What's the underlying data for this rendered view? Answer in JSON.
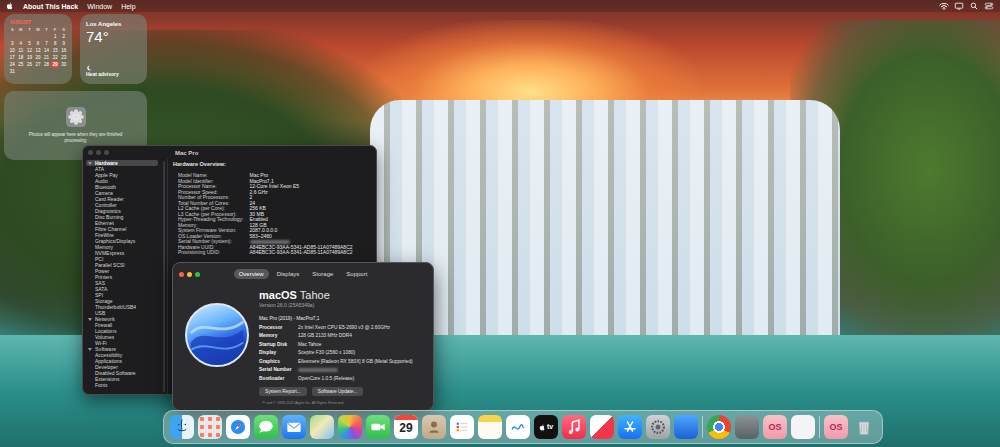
{
  "menu_bar": {
    "app_name": "About This Hack",
    "items": [
      "Window",
      "Help"
    ]
  },
  "calendar_widget": {
    "month": "AUGUST",
    "weekdays": [
      "S",
      "M",
      "T",
      "W",
      "T",
      "F",
      "S"
    ],
    "weeks": [
      [
        {
          "day": "1",
          "today": false
        },
        {
          "day": "2",
          "today": false
        }
      ],
      [
        {
          "day": "3",
          "today": false
        },
        {
          "day": "4",
          "today": false
        },
        {
          "day": "5",
          "today": false
        },
        {
          "day": "6",
          "today": false
        },
        {
          "day": "7",
          "today": false
        },
        {
          "day": "8",
          "today": false
        },
        {
          "day": "9",
          "today": false
        }
      ],
      [
        {
          "day": "10",
          "today": false
        },
        {
          "day": "11",
          "today": false
        },
        {
          "day": "12",
          "today": false
        },
        {
          "day": "13",
          "today": false
        },
        {
          "day": "14",
          "today": false
        },
        {
          "day": "15",
          "today": false
        },
        {
          "day": "16",
          "today": false
        }
      ],
      [
        {
          "day": "17",
          "today": false
        },
        {
          "day": "18",
          "today": false
        },
        {
          "day": "19",
          "today": false
        },
        {
          "day": "20",
          "today": false
        },
        {
          "day": "21",
          "today": false
        },
        {
          "day": "22",
          "today": false
        },
        {
          "day": "23",
          "today": false
        }
      ],
      [
        {
          "day": "24",
          "today": false
        },
        {
          "day": "25",
          "today": false
        },
        {
          "day": "26",
          "today": false
        },
        {
          "day": "27",
          "today": false
        },
        {
          "day": "28",
          "today": false
        },
        {
          "day": "29",
          "today": true
        },
        {
          "day": "30",
          "today": false
        }
      ],
      [
        {
          "day": "31",
          "today": false
        }
      ]
    ]
  },
  "weather_widget": {
    "city": "Los Angeles",
    "temperature": "74°",
    "condition": "Heat advisory"
  },
  "photos_widget": {
    "message": "Photos will appear here when they are finished processing"
  },
  "system_report": {
    "title": "Mac Pro",
    "sidebar": [
      {
        "label": "Hardware",
        "kind": "group",
        "expanded": true,
        "selected": true
      },
      {
        "label": "ATA",
        "kind": "item",
        "expanded": false,
        "selected": false
      },
      {
        "label": "Apple Pay",
        "kind": "item",
        "expanded": false,
        "selected": false
      },
      {
        "label": "Audio",
        "kind": "item",
        "expanded": false,
        "selected": false
      },
      {
        "label": "Bluetooth",
        "kind": "item",
        "expanded": false,
        "selected": false
      },
      {
        "label": "Camera",
        "kind": "item",
        "expanded": false,
        "selected": false
      },
      {
        "label": "Card Reader",
        "kind": "item",
        "expanded": false,
        "selected": false
      },
      {
        "label": "Controller",
        "kind": "item",
        "expanded": false,
        "selected": false
      },
      {
        "label": "Diagnostics",
        "kind": "item",
        "expanded": false,
        "selected": false
      },
      {
        "label": "Disc Burning",
        "kind": "item",
        "expanded": false,
        "selected": false
      },
      {
        "label": "Ethernet",
        "kind": "item",
        "expanded": false,
        "selected": false
      },
      {
        "label": "Fibre Channel",
        "kind": "item",
        "expanded": false,
        "selected": false
      },
      {
        "label": "FireWire",
        "kind": "item",
        "expanded": false,
        "selected": false
      },
      {
        "label": "Graphics/Displays",
        "kind": "item",
        "expanded": false,
        "selected": false
      },
      {
        "label": "Memory",
        "kind": "item",
        "expanded": false,
        "selected": false
      },
      {
        "label": "NVMExpress",
        "kind": "item",
        "expanded": false,
        "selected": false
      },
      {
        "label": "PCI",
        "kind": "item",
        "expanded": false,
        "selected": false
      },
      {
        "label": "Parallel SCSI",
        "kind": "item",
        "expanded": false,
        "selected": false
      },
      {
        "label": "Power",
        "kind": "item",
        "expanded": false,
        "selected": false
      },
      {
        "label": "Printers",
        "kind": "item",
        "expanded": false,
        "selected": false
      },
      {
        "label": "SAS",
        "kind": "item",
        "expanded": false,
        "selected": false
      },
      {
        "label": "SATA",
        "kind": "item",
        "expanded": false,
        "selected": false
      },
      {
        "label": "SPI",
        "kind": "item",
        "expanded": false,
        "selected": false
      },
      {
        "label": "Storage",
        "kind": "item",
        "expanded": false,
        "selected": false
      },
      {
        "label": "Thunderbolt/USB4",
        "kind": "item",
        "expanded": false,
        "selected": false
      },
      {
        "label": "USB",
        "kind": "item",
        "expanded": false,
        "selected": false
      },
      {
        "label": "Network",
        "kind": "group",
        "expanded": true,
        "selected": false
      },
      {
        "label": "Firewall",
        "kind": "item",
        "expanded": false,
        "selected": false
      },
      {
        "label": "Locations",
        "kind": "item",
        "expanded": false,
        "selected": false
      },
      {
        "label": "Volumes",
        "kind": "item",
        "expanded": false,
        "selected": false
      },
      {
        "label": "Wi-Fi",
        "kind": "item",
        "expanded": false,
        "selected": false
      },
      {
        "label": "Software",
        "kind": "group",
        "expanded": true,
        "selected": false
      },
      {
        "label": "Accessibility",
        "kind": "item",
        "expanded": false,
        "selected": false
      },
      {
        "label": "Applications",
        "kind": "item",
        "expanded": false,
        "selected": false
      },
      {
        "label": "Developer",
        "kind": "item",
        "expanded": false,
        "selected": false
      },
      {
        "label": "Disabled Software",
        "kind": "item",
        "expanded": false,
        "selected": false
      },
      {
        "label": "Extensions",
        "kind": "item",
        "expanded": false,
        "selected": false
      },
      {
        "label": "Fonts",
        "kind": "item",
        "expanded": false,
        "selected": false
      }
    ],
    "heading": "Hardware Overview:",
    "rows": [
      {
        "label": "Model Name:",
        "value": "Mac Pro",
        "redacted": false
      },
      {
        "label": "Model Identifier:",
        "value": "MacPro7,1",
        "redacted": false
      },
      {
        "label": "Processor Name:",
        "value": "12-Core Intel Xeon E5",
        "redacted": false
      },
      {
        "label": "Processor Speed:",
        "value": "2.6 GHz",
        "redacted": false
      },
      {
        "label": "Number of Processors:",
        "value": "2",
        "redacted": false
      },
      {
        "label": "Total Number of Cores:",
        "value": "24",
        "redacted": false
      },
      {
        "label": "L2 Cache (per Core):",
        "value": "256 KB",
        "redacted": false
      },
      {
        "label": "L3 Cache (per Processor):",
        "value": "30 MB",
        "redacted": false
      },
      {
        "label": "Hyper-Threading Technology:",
        "value": "Enabled",
        "redacted": false
      },
      {
        "label": "Memory:",
        "value": "128 GB",
        "redacted": false
      },
      {
        "label": "System Firmware Version:",
        "value": "2087.0.0.0.0",
        "redacted": false
      },
      {
        "label": "OS Loader Version:",
        "value": "583~2480",
        "redacted": false
      },
      {
        "label": "Serial Number (system):",
        "redacted": true
      },
      {
        "label": "Hardware UUID:",
        "value": "A84EBC3C-93AA-5341-AD85-11A07489A8C2",
        "redacted": false
      },
      {
        "label": "Provisioning UDID:",
        "value": "A84EBC3C-93AA-5341-AD85-11A07489A8C2",
        "redacted": false
      }
    ]
  },
  "about_window": {
    "tabs": [
      {
        "label": "Overview",
        "selected": true
      },
      {
        "label": "Displays",
        "selected": false
      },
      {
        "label": "Storage",
        "selected": false
      },
      {
        "label": "Support",
        "selected": false
      }
    ],
    "os_name": "macOS",
    "os_release": "Tahoe",
    "version": "Version 26.0 (25A5349a)",
    "model": "Mac Pro (2019) - MacPro7,1",
    "specs": [
      {
        "label": "Processor",
        "value": "2x Intel Xeon CPU E5-2690 v3 @ 2.60GHz",
        "redacted": false
      },
      {
        "label": "Memory",
        "value": "128 GB 2133 MHz DDR4",
        "redacted": false
      },
      {
        "label": "Startup Disk",
        "value": "Mac Tahoe",
        "redacted": false
      },
      {
        "label": "Display",
        "value": "Sceptre F30 (2560 x 1080)",
        "redacted": false
      },
      {
        "label": "Graphics",
        "value": "Ellesmere [Radeon RX 580X] 8 GB (Metal Supported)",
        "redacted": false
      },
      {
        "label": "Serial Number",
        "redacted": true
      },
      {
        "label": "Bootloader",
        "value": "OpenCore 1.0.5 (Release)",
        "redacted": false
      }
    ],
    "buttons": [
      "System Report...",
      "Software Update..."
    ],
    "footer": "™ and © 1983-2025 Apple Inc. All Rights Reserved."
  },
  "dock": {
    "calendar_day": "29",
    "tv_label": "tv",
    "os_labels": [
      "OS",
      "OS"
    ]
  }
}
